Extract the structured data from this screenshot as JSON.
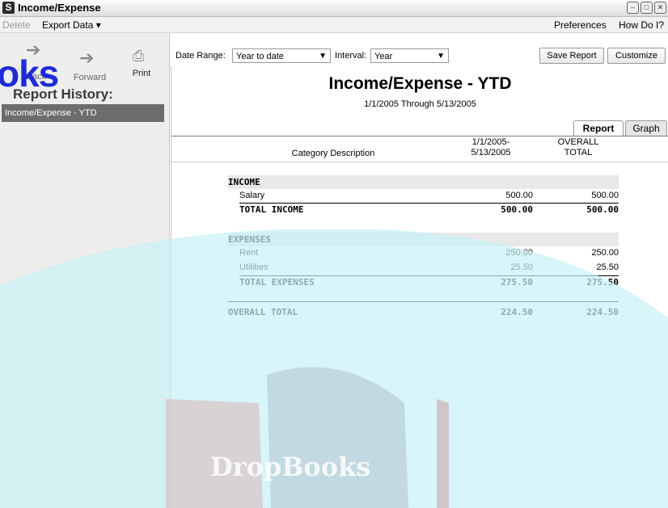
{
  "window": {
    "title": "Income/Expense",
    "logo": "S",
    "controls": [
      "minimize-icon",
      "restore-icon",
      "close-icon"
    ]
  },
  "menu": {
    "delete": "Delete",
    "export_data": "Export Data",
    "preferences": "Preferences",
    "how_do_i": "How Do I?"
  },
  "toolbar": {
    "back": "Back",
    "forward": "Forward",
    "print": "Print"
  },
  "history": {
    "title": "Report History:",
    "items": [
      "Income/Expense - YTD"
    ]
  },
  "overlay": "oks",
  "controls": {
    "date_range_label": "Date Range:",
    "date_range_value": "Year to date",
    "interval_label": "Interval:",
    "interval_value": "Year",
    "save_report": "Save Report",
    "customize": "Customize"
  },
  "report": {
    "title": "Income/Expense - YTD",
    "subtitle": "1/1/2005 Through 5/13/2005",
    "tabs": {
      "report": "Report",
      "graph": "Graph"
    },
    "columns": {
      "category": "Category Description",
      "period_line1": "1/1/2005-",
      "period_line2": "5/13/2005",
      "overall_line1": "OVERALL",
      "overall_line2": "TOTAL"
    },
    "income": {
      "header": "INCOME",
      "rows": [
        {
          "label": "Salary",
          "period": "500.00",
          "overall": "500.00"
        }
      ],
      "total": {
        "label": "TOTAL INCOME",
        "period": "500.00",
        "overall": "500.00"
      }
    },
    "expenses": {
      "header": "EXPENSES",
      "rows": [
        {
          "label": "Rent",
          "period": "250.00",
          "overall": "250.00"
        },
        {
          "label": "Utilities",
          "period": "25.50",
          "overall": "25.50"
        }
      ],
      "total": {
        "label": "TOTAL EXPENSES",
        "period": "275.50",
        "overall": "275.50"
      }
    },
    "grand_total": {
      "label": "OVERALL TOTAL",
      "period": "224.50",
      "overall": "224.50"
    }
  },
  "watermark_text": "DropBooks",
  "colors": {
    "overlay_blue": "#1e2bd6",
    "watermark_cyan": "#c7f1f6",
    "selected_item": "#6d6d6d"
  }
}
